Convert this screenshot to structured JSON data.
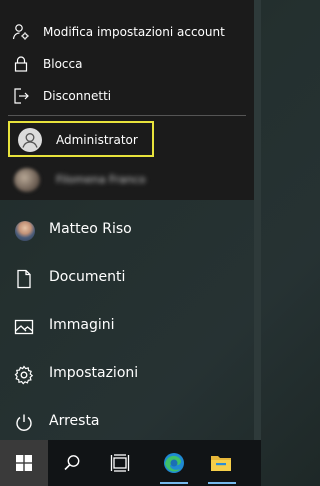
{
  "account_menu": {
    "items": [
      {
        "label": "Modifica impostazioni account",
        "icon": "person-settings-icon"
      },
      {
        "label": "Blocca",
        "icon": "lock-icon"
      },
      {
        "label": "Disconnetti",
        "icon": "sign-out-icon"
      }
    ],
    "accounts": [
      {
        "label": "Administrator",
        "icon": "default-avatar-icon"
      },
      {
        "label": "Filomena Franco",
        "icon": "user-photo"
      }
    ]
  },
  "start_menu": {
    "items": [
      {
        "label": "Matteo Riso",
        "icon": "user-avatar"
      },
      {
        "label": "Documenti",
        "icon": "document-icon"
      },
      {
        "label": "Immagini",
        "icon": "image-icon"
      },
      {
        "label": "Impostazioni",
        "icon": "gear-icon"
      },
      {
        "label": "Arresta",
        "icon": "power-icon"
      }
    ]
  },
  "taskbar": {
    "buttons": [
      "windows-start-icon",
      "search-icon",
      "task-view-icon",
      "edge-icon",
      "file-explorer-icon"
    ],
    "highlight_color": "#e8e33c",
    "active_indicator_color": "#76b9ed"
  }
}
